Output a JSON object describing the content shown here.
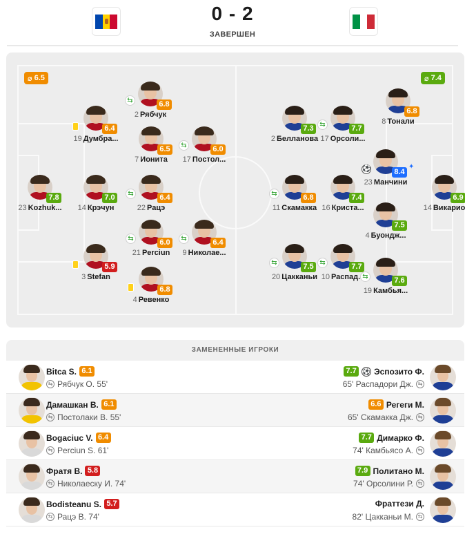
{
  "colors": {
    "orange": "#f08c00",
    "green": "#5aaa0f",
    "red": "#d21e1e",
    "blue": "#1e6eff",
    "yellow_card": "#ffd11a"
  },
  "header": {
    "home_flag": "moldova-flag",
    "away_flag": "italy-flag",
    "score": "0 - 2",
    "status": "ЗАВЕРШЕН"
  },
  "home": {
    "team_rating": "6.5",
    "players": [
      {
        "num": "2",
        "name": "Рябчук",
        "rating": "6.8",
        "color": "orange",
        "sub": true
      },
      {
        "num": "19",
        "name": "Думбра...",
        "rating": "6.4",
        "color": "orange",
        "card": true
      },
      {
        "num": "7",
        "name": "Ионита",
        "rating": "6.5",
        "color": "orange"
      },
      {
        "num": "17",
        "name": "Постол...",
        "rating": "6.0",
        "color": "orange",
        "sub": true
      },
      {
        "num": "23",
        "name": "Kozhuk...",
        "rating": "7.8",
        "color": "green"
      },
      {
        "num": "14",
        "name": "Крэчун",
        "rating": "7.0",
        "color": "green"
      },
      {
        "num": "22",
        "name": "Рацэ",
        "rating": "6.4",
        "color": "orange",
        "sub": true
      },
      {
        "num": "21",
        "name": "Perciun",
        "rating": "6.0",
        "color": "orange",
        "sub": true
      },
      {
        "num": "9",
        "name": "Николае...",
        "rating": "6.4",
        "color": "orange",
        "sub": true
      },
      {
        "num": "3",
        "name": "Stefan",
        "rating": "5.9",
        "color": "red",
        "card": true
      },
      {
        "num": "4",
        "name": "Ревенко",
        "rating": "6.8",
        "color": "orange",
        "card": true
      }
    ]
  },
  "away": {
    "team_rating": "7.4",
    "players": [
      {
        "num": "2",
        "name": "Белланова",
        "rating": "7.3",
        "color": "green"
      },
      {
        "num": "17",
        "name": "Орсоли...",
        "rating": "7.7",
        "color": "green",
        "sub": true
      },
      {
        "num": "8",
        "name": "Тонали",
        "rating": "6.8",
        "color": "orange"
      },
      {
        "num": "23",
        "name": "Манчини",
        "rating": "8.4",
        "color": "blue",
        "goal": true,
        "star": true
      },
      {
        "num": "11",
        "name": "Скамакка",
        "rating": "6.8",
        "color": "orange",
        "sub": true
      },
      {
        "num": "16",
        "name": "Криста...",
        "rating": "7.4",
        "color": "green"
      },
      {
        "num": "14",
        "name": "Викарио",
        "rating": "6.9",
        "color": "green"
      },
      {
        "num": "4",
        "name": "Буондж...",
        "rating": "7.5",
        "color": "green"
      },
      {
        "num": "20",
        "name": "Цакканьи",
        "rating": "7.5",
        "color": "green",
        "sub": true
      },
      {
        "num": "10",
        "name": "Распад...",
        "rating": "7.7",
        "color": "green",
        "sub": true
      },
      {
        "num": "19",
        "name": "Камбья...",
        "rating": "7.6",
        "color": "green",
        "sub": true
      }
    ]
  },
  "subs": {
    "title": "ЗАМЕНЕННЫЕ ИГРОКИ",
    "rows": [
      {
        "home": {
          "name": "Bitca S.",
          "rating": "6.1",
          "color": "orange",
          "detail": "Рябчук О. 55'"
        },
        "away": {
          "name": "Эспозито Ф.",
          "rating": "7.7",
          "color": "green",
          "detail": "65' Распадори Дж.",
          "goal": true
        }
      },
      {
        "home": {
          "name": "Дамашкан В.",
          "rating": "6.1",
          "color": "orange",
          "detail": "Постолаки В. 55'"
        },
        "away": {
          "name": "Регеги М.",
          "rating": "6.6",
          "color": "orange",
          "detail": "65' Скамакка Дж."
        }
      },
      {
        "home": {
          "name": "Bogaciuc V.",
          "rating": "6.4",
          "color": "orange",
          "detail": "Perciun S. 61'"
        },
        "away": {
          "name": "Димарко Ф.",
          "rating": "7.7",
          "color": "green",
          "detail": "74' Камбьясо А."
        }
      },
      {
        "home": {
          "name": "Фратя В.",
          "rating": "5.8",
          "color": "red",
          "detail": "Николаеску И. 74'"
        },
        "away": {
          "name": "Политано М.",
          "rating": "7.9",
          "color": "green",
          "detail": "74' Орсолини Р."
        }
      },
      {
        "home": {
          "name": "Bodisteanu S.",
          "rating": "5.7",
          "color": "red",
          "detail": "Рацэ В. 74'"
        },
        "away": {
          "name": "Фраттези Д.",
          "rating": "",
          "color": "green",
          "detail": "82' Цакканьи М."
        }
      }
    ]
  }
}
